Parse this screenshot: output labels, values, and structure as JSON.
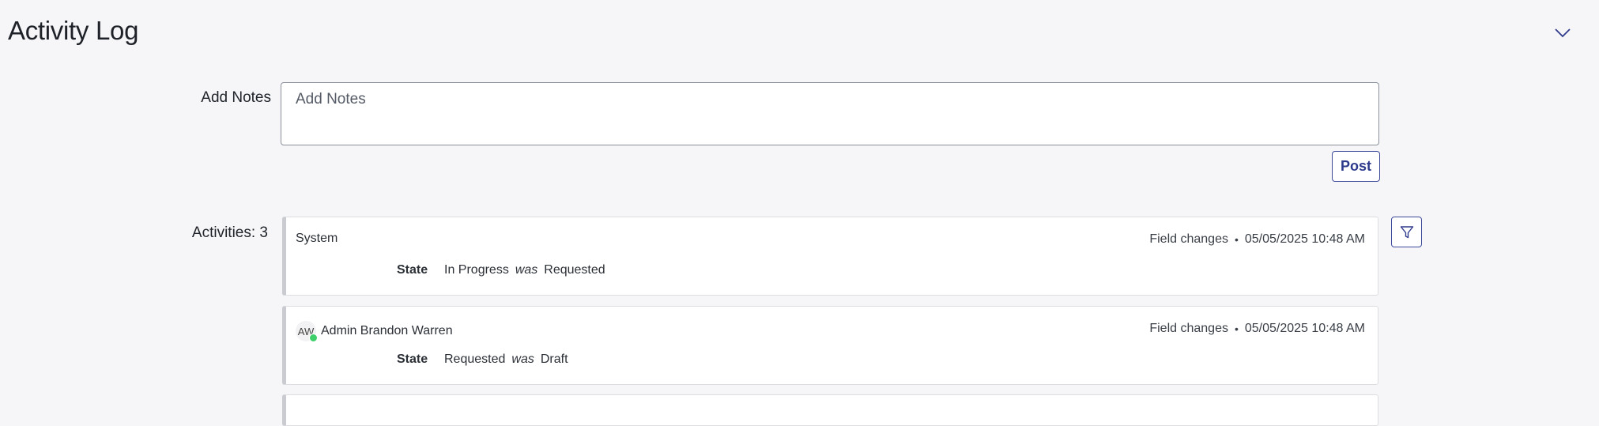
{
  "header": {
    "title": "Activity Log",
    "collapse_icon": "chevron-down-icon"
  },
  "notes": {
    "label": "Add Notes",
    "placeholder": "Add Notes",
    "value": ""
  },
  "post_button": {
    "label": "Post"
  },
  "activities": {
    "label": "Activities: 3",
    "filter_icon": "filter-icon",
    "items": [
      {
        "author": "System",
        "avatar_initials": "",
        "type": "Field changes",
        "separator": "•",
        "timestamp": "05/05/2025 10:48 AM",
        "field": "State",
        "new_value": "In Progress",
        "was_label": "was",
        "old_value": "Requested"
      },
      {
        "author": "Admin Brandon Warren",
        "avatar_initials": "AW",
        "type": "Field changes",
        "separator": "•",
        "timestamp": "05/05/2025 10:48 AM",
        "field": "State",
        "new_value": "Requested",
        "was_label": "was",
        "old_value": "Draft"
      }
    ]
  },
  "colors": {
    "accent": "#2e3a8c",
    "presence": "#3fd06b",
    "background": "#f6f6f8"
  }
}
